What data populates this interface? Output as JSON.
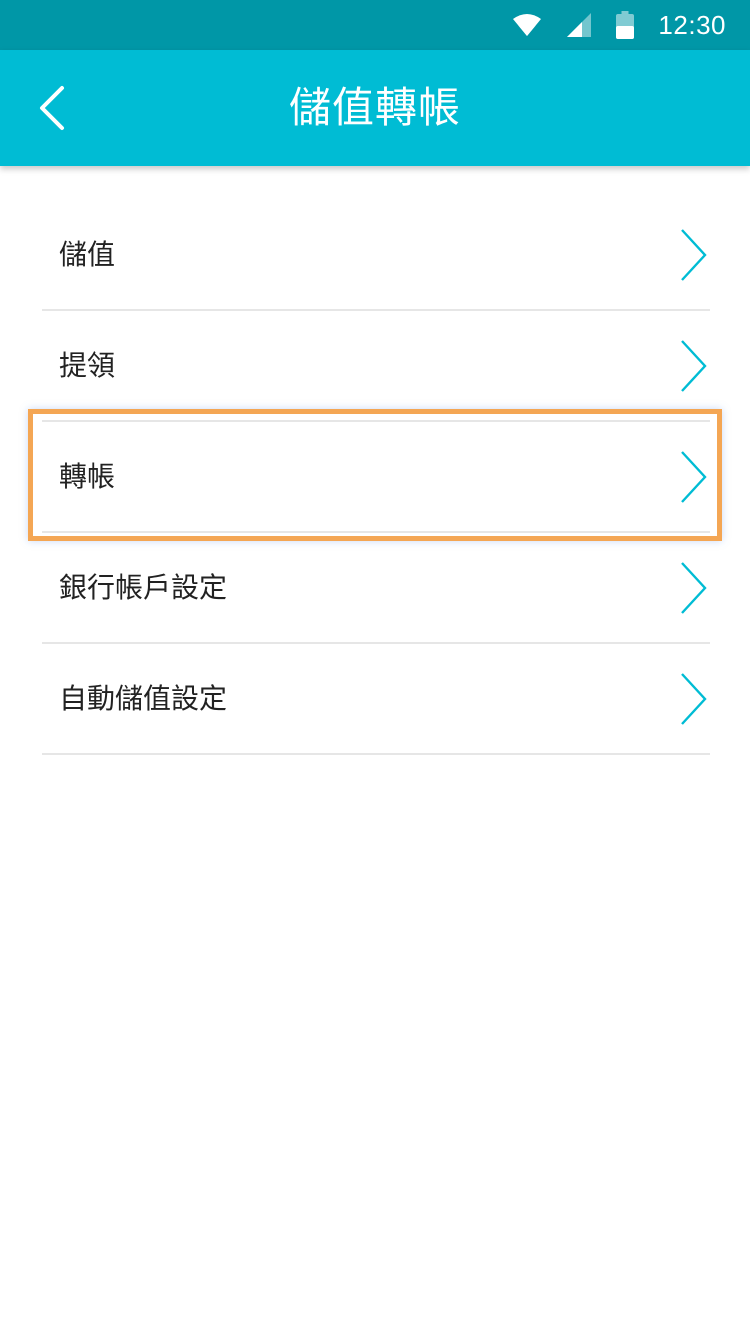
{
  "status_bar": {
    "time": "12:30",
    "icons": [
      "wifi-icon",
      "signal-icon",
      "battery-icon"
    ]
  },
  "header": {
    "title": "儲值轉帳",
    "back_icon": "chevron-left-icon"
  },
  "menu": {
    "items": [
      {
        "label": "儲值"
      },
      {
        "label": "提領"
      },
      {
        "label": "轉帳",
        "highlighted": true
      },
      {
        "label": "銀行帳戶設定"
      },
      {
        "label": "自動儲值設定"
      }
    ],
    "chevron_icon": "chevron-right-icon"
  },
  "colors": {
    "status_bar": "#0097a7",
    "app_bar": "#00bcd4",
    "accent": "#00bcd4",
    "highlight": "#f4a654",
    "divider": "#e6e6e6"
  }
}
